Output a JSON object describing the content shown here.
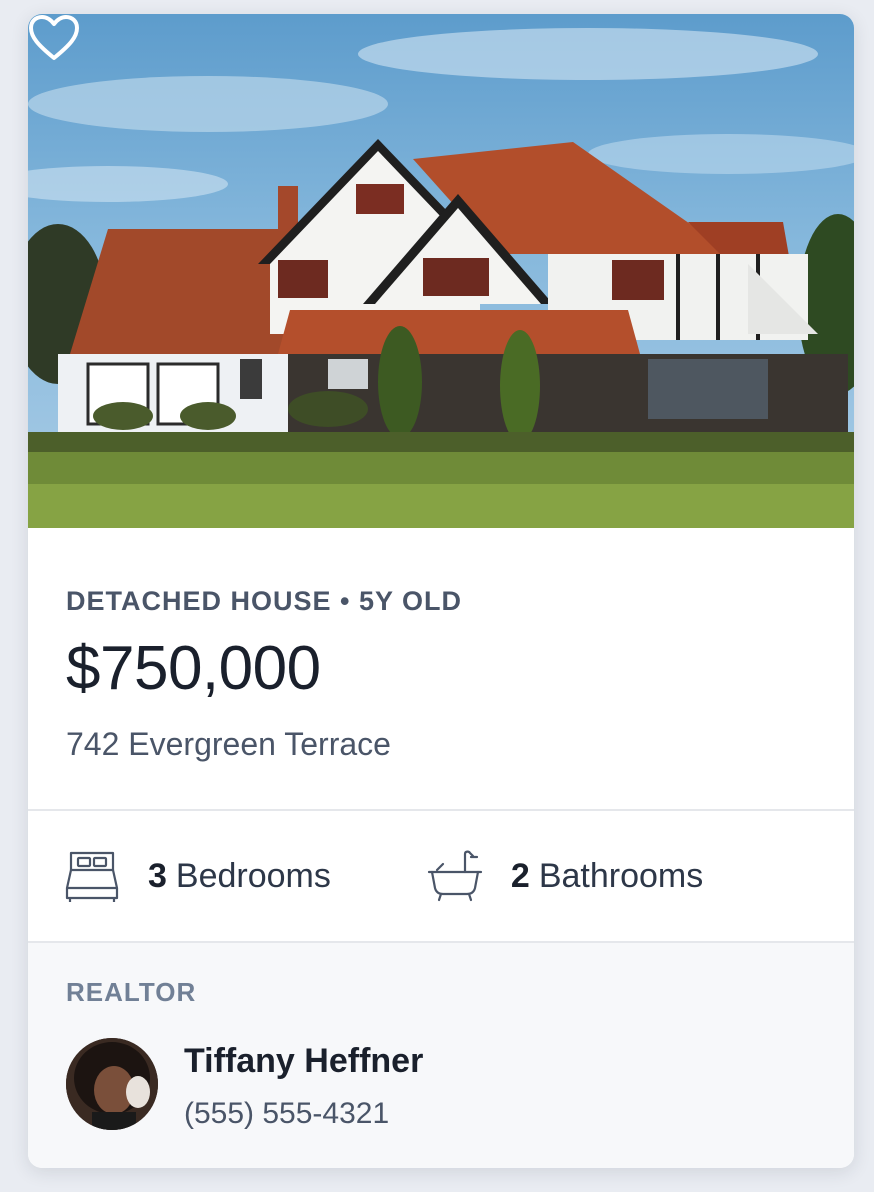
{
  "listing": {
    "meta": "DETACHED HOUSE • 5Y OLD",
    "price": "$750,000",
    "address": "742 Evergreen Terrace",
    "photo_alt": "House photo",
    "favorite_icon": "heart-outline-icon"
  },
  "features": {
    "bedrooms": {
      "count": "3",
      "label": "Bedrooms",
      "icon": "bed-icon"
    },
    "bathrooms": {
      "count": "2",
      "label": "Bathrooms",
      "icon": "bathtub-icon"
    }
  },
  "realtor": {
    "title": "REALTOR",
    "name": "Tiffany Heffner",
    "phone": "(555) 555-4321",
    "avatar_icon": "avatar-photo"
  },
  "colors": {
    "page_bg": "#e9ecf2",
    "card_bg": "#ffffff",
    "realtor_bg": "#f7f8fa",
    "text_dark": "#1a202c",
    "text_muted": "#4a5568",
    "text_label": "#718096"
  }
}
